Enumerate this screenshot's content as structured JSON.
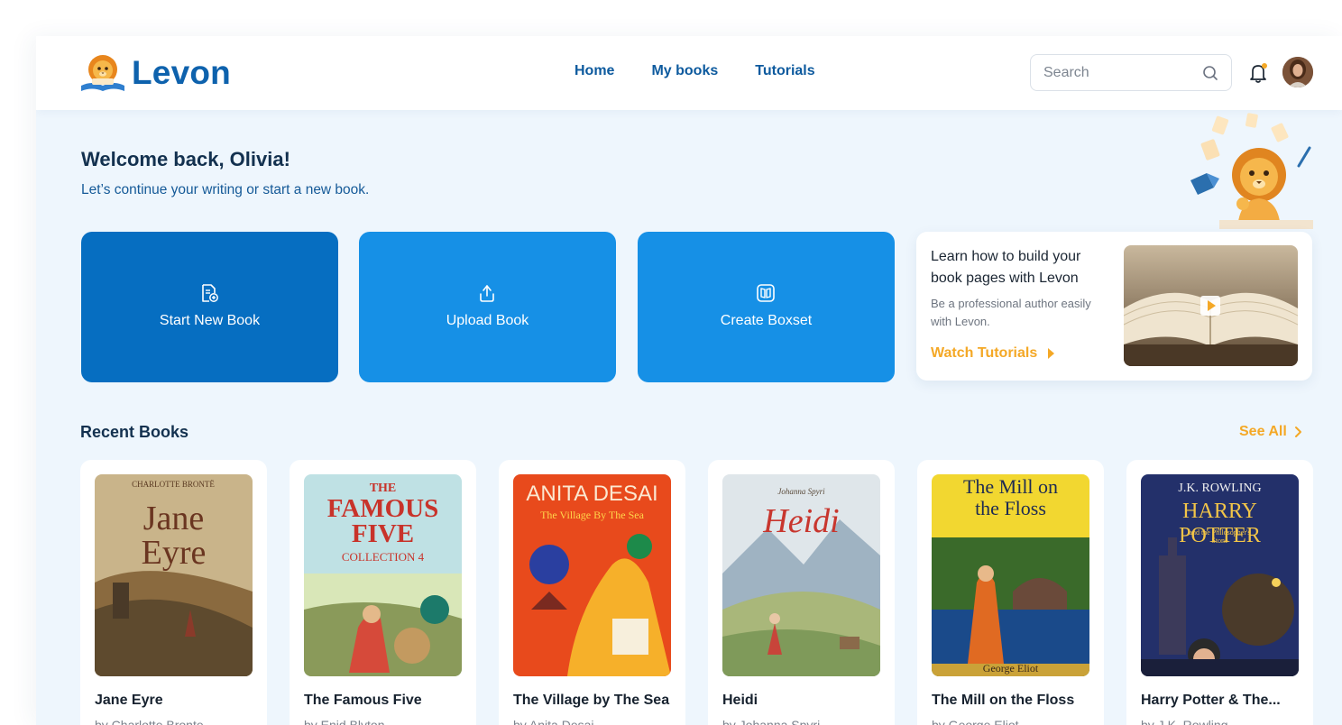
{
  "header": {
    "brand": "Levon",
    "nav": [
      "Home",
      "My books",
      "Tutorials"
    ],
    "search_placeholder": "Search"
  },
  "welcome": {
    "title": "Welcome back, Olivia!",
    "subtitle": "Let’s continue your writing or start a new book."
  },
  "actions": [
    {
      "label": "Start New Book",
      "icon": "new-book-icon",
      "color": "#066ec1"
    },
    {
      "label": "Upload Book",
      "icon": "upload-icon",
      "color": "#1690e6"
    },
    {
      "label": "Create Boxset",
      "icon": "book-icon",
      "color": "#1690e6"
    }
  ],
  "tutorial": {
    "title": "Learn how to build your book pages with Levon",
    "description": "Be a professional author easily with Levon.",
    "link": "Watch Tutorials"
  },
  "recent": {
    "title": "Recent Books",
    "see_all": "See All",
    "books": [
      {
        "title": "Jane Eyre",
        "author": "by Charlotte Bronte",
        "cover": {
          "top": "CHARLOTTE BRONTË",
          "main": "Jane Eyre",
          "bottom": ""
        }
      },
      {
        "title": "The Famous Five",
        "author": "by Enid Blyton",
        "cover": {
          "top": "THE",
          "main": "FAMOUS FIVE",
          "bottom": "COLLECTION 4"
        }
      },
      {
        "title": "The Village by The Sea",
        "author": "by Anita Desai",
        "cover": {
          "top": "ANITA DESAI",
          "main": "The Village By The Sea",
          "bottom": ""
        }
      },
      {
        "title": "Heidi",
        "author": "by Johanna Spyri",
        "cover": {
          "top": "Johanna Spyri",
          "main": "Heidi",
          "bottom": ""
        }
      },
      {
        "title": "The Mill on the Floss",
        "author": "by George Eliot",
        "cover": {
          "top": "",
          "main": "The Mill on the Floss",
          "bottom": "George Eliot"
        }
      },
      {
        "title": "Harry Potter & The...",
        "author": "by J.K. Rowling",
        "cover": {
          "top": "J.K. ROWLING",
          "main": "HARRY POTTER",
          "bottom": "and the Philosopher's Stone"
        }
      }
    ]
  },
  "colors": {
    "brand": "#0e62ad",
    "accent": "#f4a826",
    "primary": "#066ec1",
    "secondary": "#1690e6",
    "page_bg": "#eef6fd"
  }
}
